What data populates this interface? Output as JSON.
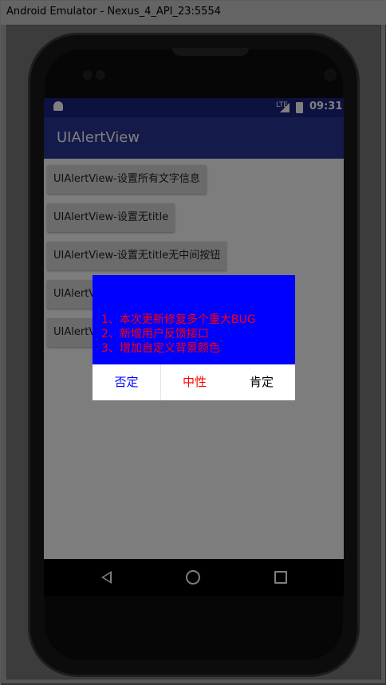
{
  "window": {
    "title": "Android Emulator - Nexus_4_API_23:5554"
  },
  "status_bar": {
    "network": "LTE",
    "time": "09:31"
  },
  "app_bar": {
    "title": "UIAlertView"
  },
  "buttons": [
    {
      "label": "UIAlertView-设置所有文字信息"
    },
    {
      "label": "UIAlertView-设置无title"
    },
    {
      "label": "UIAlertView-设置无title无中间按钮"
    },
    {
      "label": "UIAlertView-"
    },
    {
      "label": "UIAlertView-"
    }
  ],
  "dialog": {
    "message_lines": [
      "1、本次更新修复多个重大BUG",
      "2、新增用户反馈接口",
      "3、增加自定义背景颜色"
    ],
    "message_color": "#ff0000",
    "background_color": "#0000ff",
    "negative": {
      "label": "否定",
      "color": "#0000ff"
    },
    "neutral": {
      "label": "中性",
      "color": "#ff0000"
    },
    "positive": {
      "label": "肯定",
      "color": "#000000"
    }
  },
  "nav_bar": {
    "icons": [
      "back-icon",
      "home-icon",
      "recents-icon"
    ]
  },
  "colors": {
    "status_bar": "#1a237e",
    "app_bar": "#283593"
  }
}
